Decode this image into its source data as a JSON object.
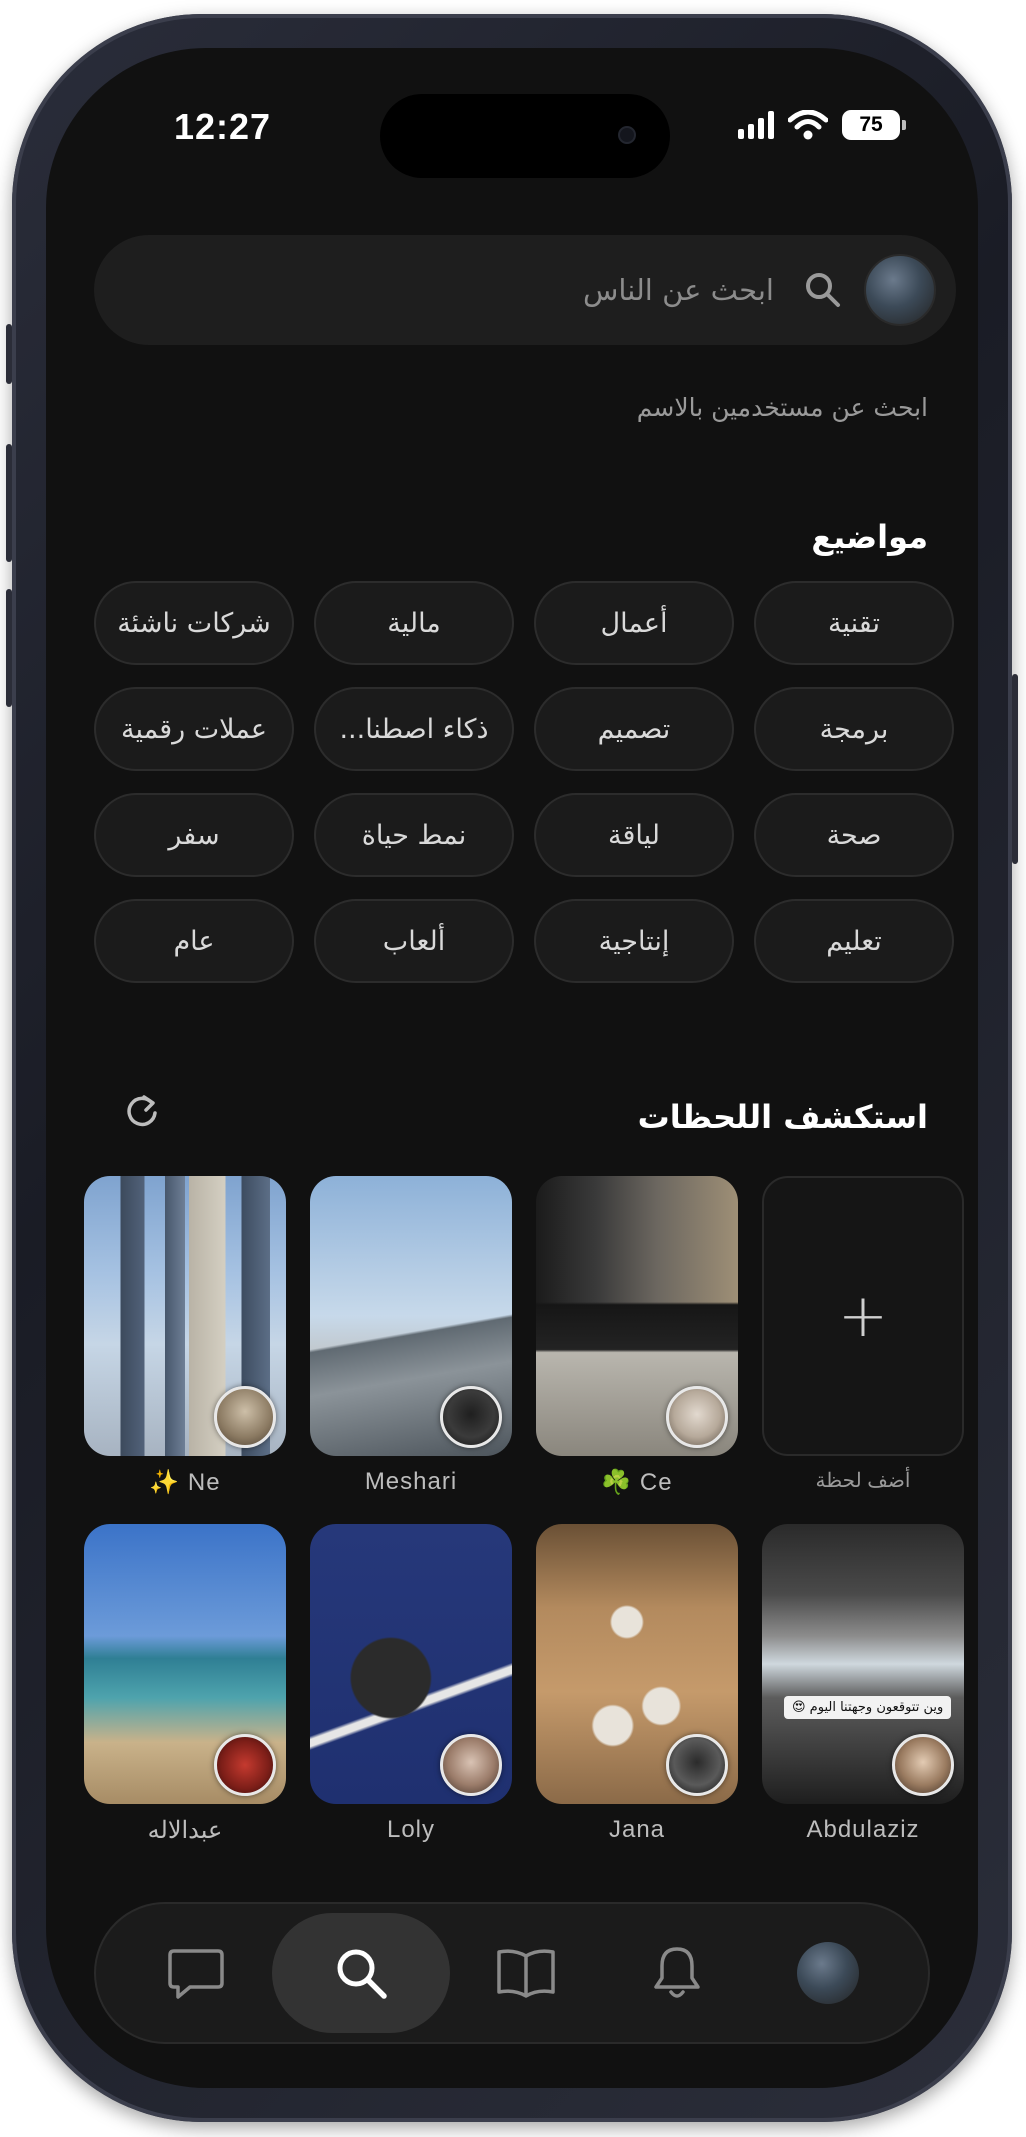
{
  "status_bar": {
    "time": "12:27",
    "battery": "75"
  },
  "search": {
    "placeholder": "ابحث عن الناس",
    "hint": "ابحث عن مستخدمين بالاسم"
  },
  "topics": {
    "title": "مواضيع",
    "items": [
      "تقنية",
      "أعمال",
      "مالية",
      "شركات ناشئة",
      "برمجة",
      "تصميم",
      "ذكاء اصطنا...",
      "عملات رقمية",
      "صحة",
      "لياقة",
      "نمط حياة",
      "سفر",
      "تعليم",
      "إنتاجية",
      "ألعاب",
      "عام"
    ]
  },
  "moments": {
    "title": "استكشف اللحظات",
    "add_label": "أضف لحظة",
    "items": [
      {
        "name": "✨ Ne"
      },
      {
        "name": "Meshari"
      },
      {
        "name": "☘️ Ce"
      },
      {
        "name": "عبدالاله"
      },
      {
        "name": "Loly"
      },
      {
        "name": "Jana"
      },
      {
        "name": "Abdulaziz",
        "caption": "وين تتوقعون وجهتنا اليوم 😍"
      }
    ]
  },
  "tabbar": {
    "icons": [
      "chat-bubble-icon",
      "search-icon",
      "book-icon",
      "bell-icon",
      "profile-avatar"
    ],
    "active": "search-icon"
  },
  "colors": {
    "background": "#111111",
    "chip": "#1b1b1b",
    "active_tab": "#333333"
  }
}
